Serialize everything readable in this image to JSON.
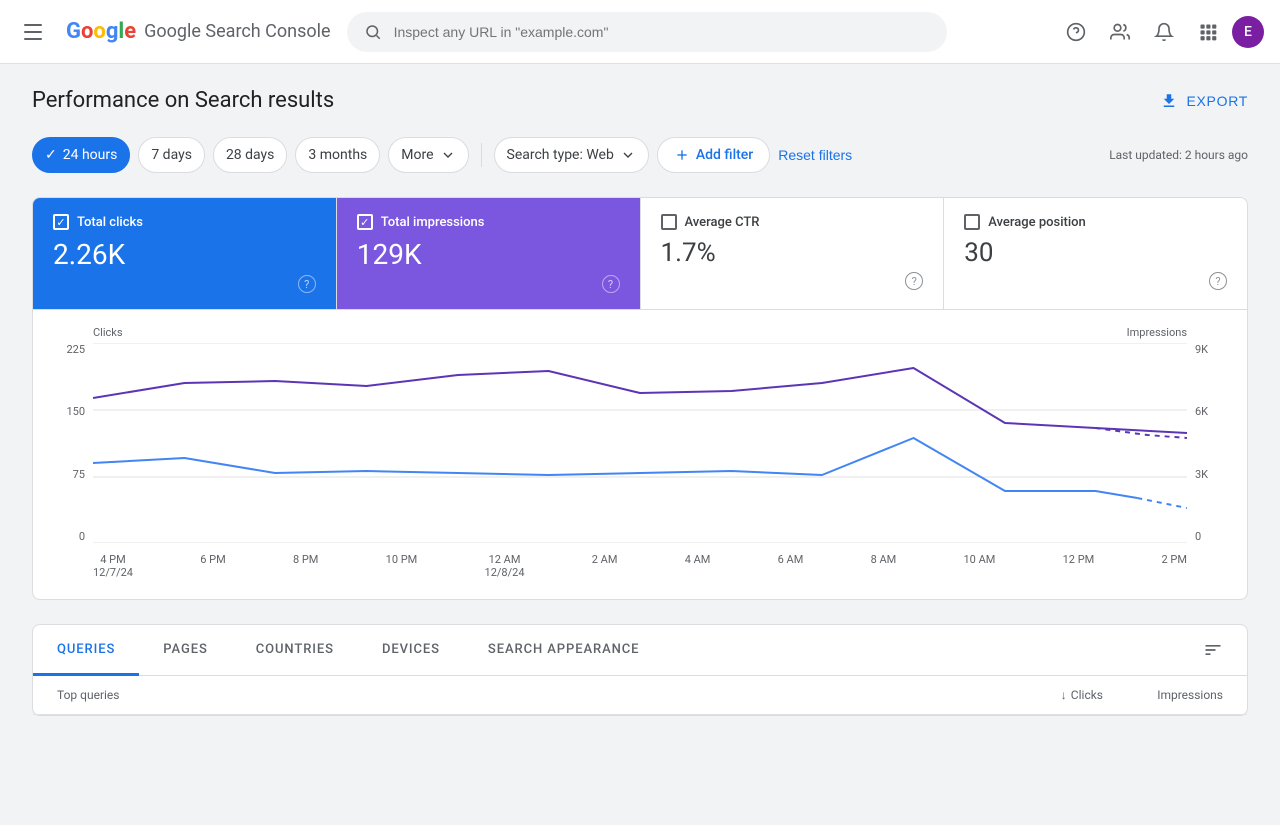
{
  "app": {
    "title": "Google Search Console",
    "logo_letters": [
      "G",
      "o",
      "o",
      "g",
      "l",
      "e"
    ],
    "search_placeholder": "Inspect any URL in \"example.com\"",
    "user_initial": "E"
  },
  "page": {
    "title": "Performance on Search results",
    "export_label": "EXPORT",
    "last_updated": "Last updated: 2 hours ago"
  },
  "filters": {
    "time_options": [
      {
        "label": "24 hours",
        "active": true
      },
      {
        "label": "7 days",
        "active": false
      },
      {
        "label": "28 days",
        "active": false
      },
      {
        "label": "3 months",
        "active": false
      }
    ],
    "more_label": "More",
    "search_type_label": "Search type: Web",
    "add_filter_label": "Add filter",
    "reset_label": "Reset filters"
  },
  "metrics": [
    {
      "id": "total_clicks",
      "label": "Total clicks",
      "value": "2.26K",
      "checked": true,
      "theme": "blue"
    },
    {
      "id": "total_impressions",
      "label": "Total impressions",
      "value": "129K",
      "checked": true,
      "theme": "purple"
    },
    {
      "id": "average_ctr",
      "label": "Average CTR",
      "value": "1.7%",
      "checked": false,
      "theme": "none"
    },
    {
      "id": "average_position",
      "label": "Average position",
      "value": "30",
      "checked": false,
      "theme": "none"
    }
  ],
  "chart": {
    "y_axis_left_label": "Clicks",
    "y_axis_right_label": "Impressions",
    "y_ticks_left": [
      "225",
      "150",
      "75",
      "0"
    ],
    "y_ticks_right": [
      "9K",
      "6K",
      "3K",
      "0"
    ],
    "x_labels": [
      {
        "line1": "4 PM",
        "line2": "12/7/24"
      },
      {
        "line1": "6 PM",
        "line2": ""
      },
      {
        "line1": "8 PM",
        "line2": ""
      },
      {
        "line1": "10 PM",
        "line2": ""
      },
      {
        "line1": "12 AM",
        "line2": "12/8/24"
      },
      {
        "line1": "2 AM",
        "line2": ""
      },
      {
        "line1": "4 AM",
        "line2": ""
      },
      {
        "line1": "6 AM",
        "line2": ""
      },
      {
        "line1": "8 AM",
        "line2": ""
      },
      {
        "line1": "10 AM",
        "line2": ""
      },
      {
        "line1": "12 PM",
        "line2": ""
      },
      {
        "line1": "2 PM",
        "line2": ""
      }
    ]
  },
  "tabs": [
    {
      "label": "QUERIES",
      "active": true
    },
    {
      "label": "PAGES",
      "active": false
    },
    {
      "label": "COUNTRIES",
      "active": false
    },
    {
      "label": "DEVICES",
      "active": false
    },
    {
      "label": "SEARCH APPEARANCE",
      "active": false
    }
  ],
  "table": {
    "col_queries": "Top queries",
    "col_clicks": "Clicks",
    "col_impressions": "Impressions"
  }
}
